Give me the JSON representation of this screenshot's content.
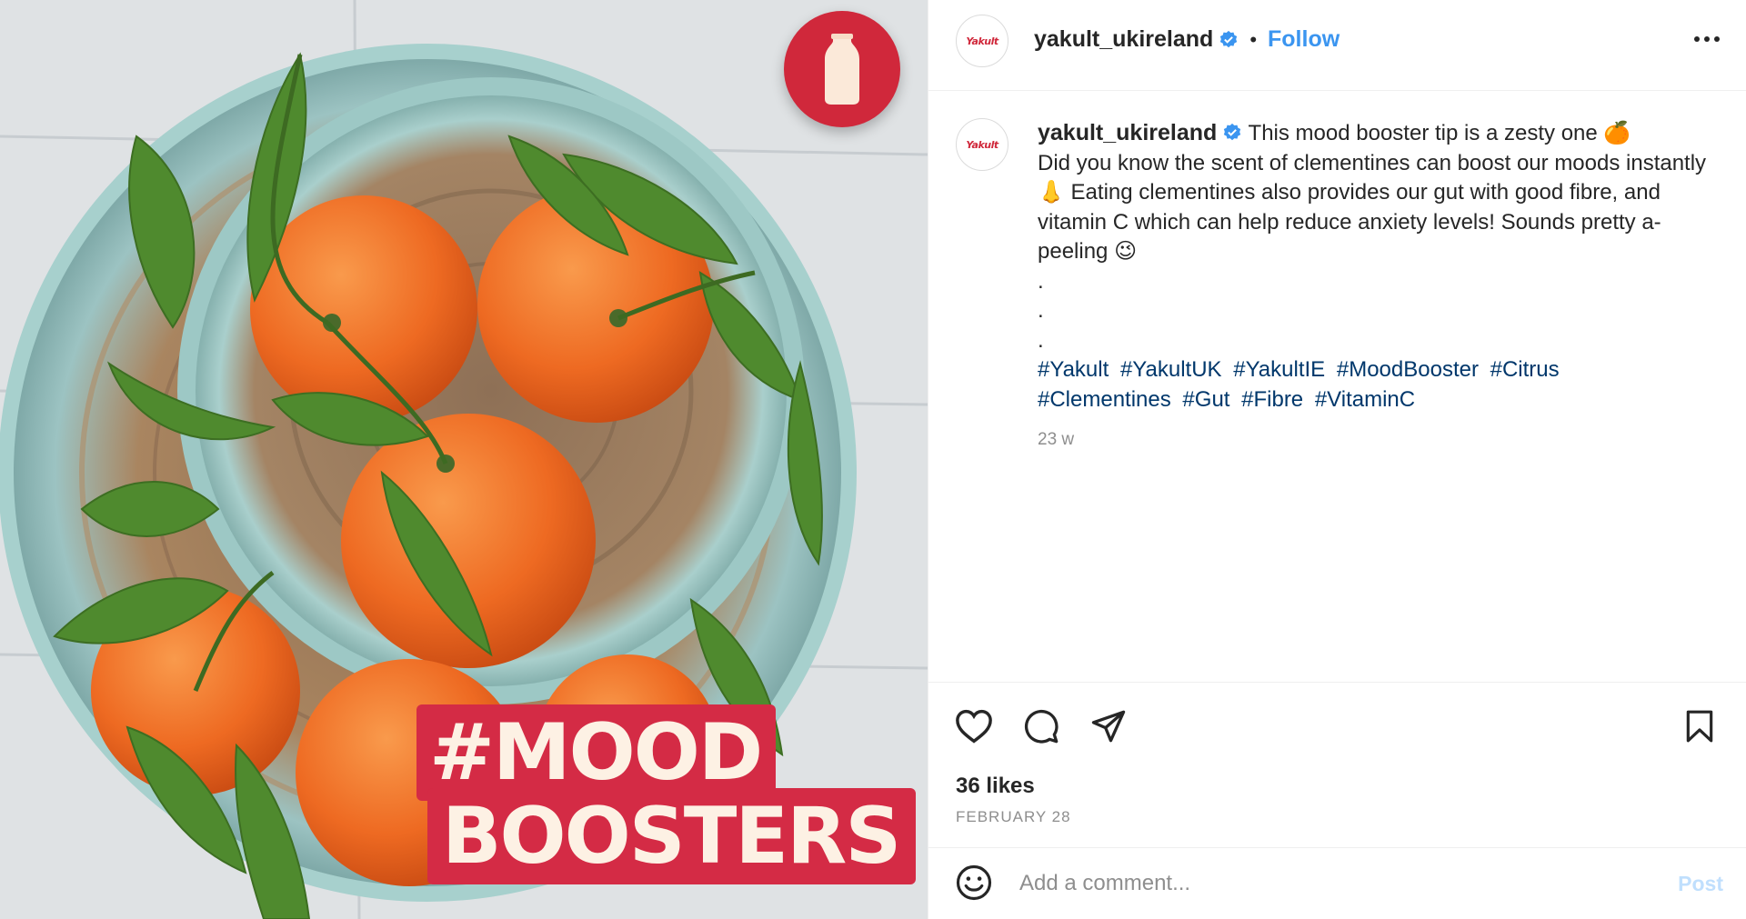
{
  "post": {
    "image": {
      "badge_icon": "yakult-bottle-icon",
      "headline_line1": "#MOOD",
      "headline_line2": "BOOSTERS"
    },
    "account": {
      "username": "yakult_ukireland",
      "verified": true,
      "avatar_logo_text": "Yakult",
      "separator": "•",
      "follow_label": "Follow"
    },
    "caption": {
      "username": "yakult_ukireland",
      "text_line1": "This mood booster tip is a zesty one 🍊",
      "text_rest": "Did you know the scent of clementines can boost our moods instantly 👃 Eating clementines also provides our gut with good fibre, and vitamin C which can help reduce anxiety levels! Sounds pretty a-peeling 😉",
      "dots": [
        ".",
        ".",
        "."
      ],
      "hashtags": [
        "#Yakult",
        "#YakultUK",
        "#YakultIE",
        "#MoodBooster",
        "#Citrus",
        "#Clementines",
        "#Gut",
        "#Fibre",
        "#VitaminC"
      ],
      "time_ago": "23 w"
    },
    "actions": {
      "icons": [
        "heart-icon",
        "comment-icon",
        "share-icon",
        "bookmark-icon"
      ],
      "likes": "36 likes",
      "date": "FEBRUARY 28"
    },
    "comment": {
      "placeholder": "Add a comment...",
      "post_label": "Post"
    }
  },
  "colors": {
    "brand_red": "#d0283b",
    "link_blue": "#3b95f0",
    "hashtag_blue": "#00376b",
    "muted": "#8e8e8e",
    "post_disabled": "#c0dffd"
  }
}
